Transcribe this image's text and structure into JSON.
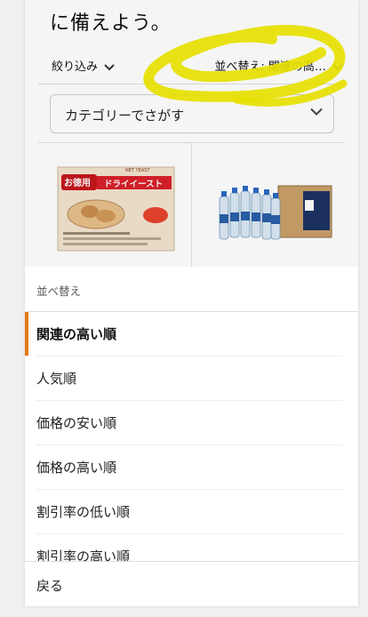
{
  "page": {
    "headline": "に備えよう。",
    "filter_label": "絞り込み",
    "sort_label": "並べ替え: 関連の高…",
    "category_placeholder": "カテゴリーでさがす",
    "product1": {
      "badge": "お徳用",
      "banner": "ドライイースト",
      "small": "NET YEAST"
    }
  },
  "sheet": {
    "title": "並べ替え",
    "options": [
      {
        "label": "関連の高い順",
        "selected": true
      },
      {
        "label": "人気順",
        "selected": false
      },
      {
        "label": "価格の安い順",
        "selected": false
      },
      {
        "label": "価格の高い順",
        "selected": false
      },
      {
        "label": "割引率の低い順",
        "selected": false
      },
      {
        "label": "割引率の高い順",
        "selected": false
      }
    ],
    "back_label": "戻る"
  },
  "colors": {
    "accent": "#e47911",
    "annotation": "#e6e000"
  }
}
